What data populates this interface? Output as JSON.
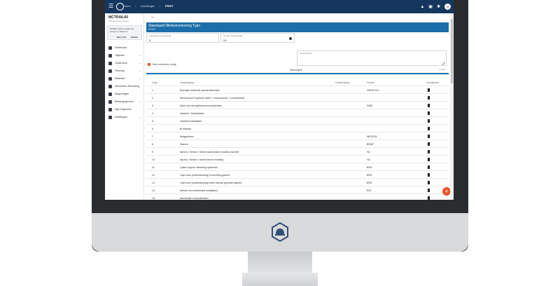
{
  "topbar": {
    "breadcrumbs": [
      "Home",
      "Instellingen"
    ],
    "breadcrumb_current": "PRWT",
    "avatar_initials": "M"
  },
  "sidebar": {
    "title": "MCTRAIL60",
    "subtitle": "McMain Online Demo",
    "card_line1": "McMain Online Leigenroll",
    "card_line2": "Versie 1.1 Build 16",
    "card_btn1": "Meer Info",
    "card_btn2": "Sluiten",
    "items": [
      {
        "label": "Dashboard",
        "chevron": false
      },
      {
        "label": "Objecten",
        "chevron": true
      },
      {
        "label": "Onderhoud",
        "chevron": true
      },
      {
        "label": "Planning",
        "chevron": true
      },
      {
        "label": "Materieel",
        "chevron": true
      },
      {
        "label": "Uitvoerders Recording",
        "chevron": false
      },
      {
        "label": "Rapportages",
        "chevron": false
      },
      {
        "label": "Beheergegevens",
        "chevron": true
      },
      {
        "label": "Mijn Gegevens",
        "chevron": false
      },
      {
        "label": "Instellingen",
        "chevron": true
      }
    ]
  },
  "main": {
    "header_title": "Standaard Werkverzekering Typo",
    "header_sub": "PRWT",
    "field1_label": "Standaard omschrijving",
    "field1_value": "3",
    "field2_label": "Termijn aantal dagen",
    "field2_value": "24",
    "checkbox_label": "Geen verdiende nodig",
    "comment_label": "Commentaar",
    "char_count": "0/4000",
    "tab_label": "Werkregels",
    "columns": [
      "Volgr.",
      "Omschrijving",
      "Omschrijving",
      "Fractie",
      "Verwijderen"
    ],
    "rows": [
      {
        "n": "1",
        "desc": "Bouwtijd werkende aandachtsvelden",
        "code": "ONGEVCH"
      },
      {
        "n": "2",
        "desc": "Werkinhoud in gebruik (werk + onbewoonde + complexiteit)",
        "code": ""
      },
      {
        "n": "3",
        "desc": "Werk van den gebiedsvoorschrijvoelen",
        "code": "SWD"
      },
      {
        "n": "4",
        "desc": "Aandeel / beheeltaken",
        "code": ""
      },
      {
        "n": "5",
        "desc": "Opmerk meldstaken",
        "code": ""
      },
      {
        "n": "6",
        "desc": "Bl blaasen",
        "code": ""
      },
      {
        "n": "7",
        "desc": "Weggerieren",
        "code": "WEGGSL"
      },
      {
        "n": "8",
        "desc": "Staiven",
        "code": "BRMF"
      },
      {
        "n": "9",
        "desc": "Nijvers / Herken / Sweet waterstraten functies inschrift",
        "code": "HLI"
      },
      {
        "n": "10",
        "desc": "Nijvers / Herken / Sweet binnen feasting",
        "code": "HLI"
      },
      {
        "n": "11",
        "desc": "Lijsten ergoxs mededing systemen",
        "code": "BRD"
      },
      {
        "n": "12",
        "desc": "Open suis (ondersteuning) & inrichting gebied",
        "code": "BRD"
      },
      {
        "n": "13",
        "desc": "Open suis (ondersteuning) teller afbouw groosten gebied",
        "code": "BRD"
      },
      {
        "n": "14",
        "desc": "Winnen een elektrische installaties",
        "code": "ELE"
      },
      {
        "n": "15",
        "desc": "Afscheiden instructiehalen",
        "code": ""
      }
    ]
  }
}
